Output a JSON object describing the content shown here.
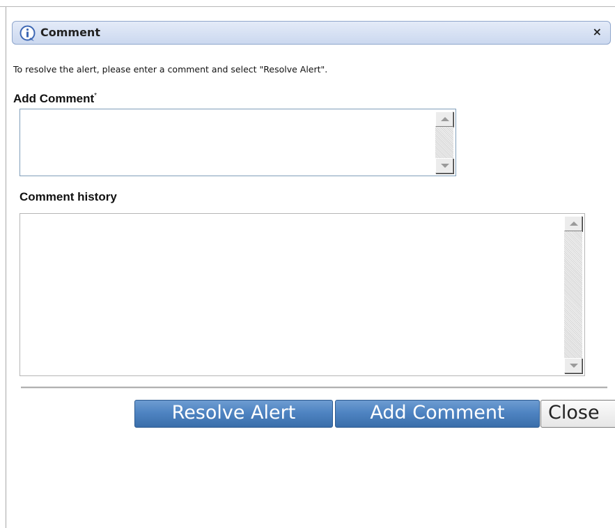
{
  "dialog": {
    "title": "Comment",
    "close_glyph": "×",
    "instructions": "To resolve the alert, please enter a comment and select \"Resolve Alert\".",
    "add_comment_label": "Add Comment",
    "required_marker": "*",
    "add_comment_value": "",
    "history_label": "Comment history",
    "history_value": ""
  },
  "buttons": {
    "resolve_label": "Resolve Alert",
    "add_comment_label": "Add Comment",
    "close_label": "Close"
  },
  "icons": {
    "title_icon": "info-icon",
    "close_icon": "close-icon"
  },
  "colors": {
    "title_bar": "#cbd8ef",
    "button_blue": "#4f84c2",
    "border": "#7f9db9"
  }
}
